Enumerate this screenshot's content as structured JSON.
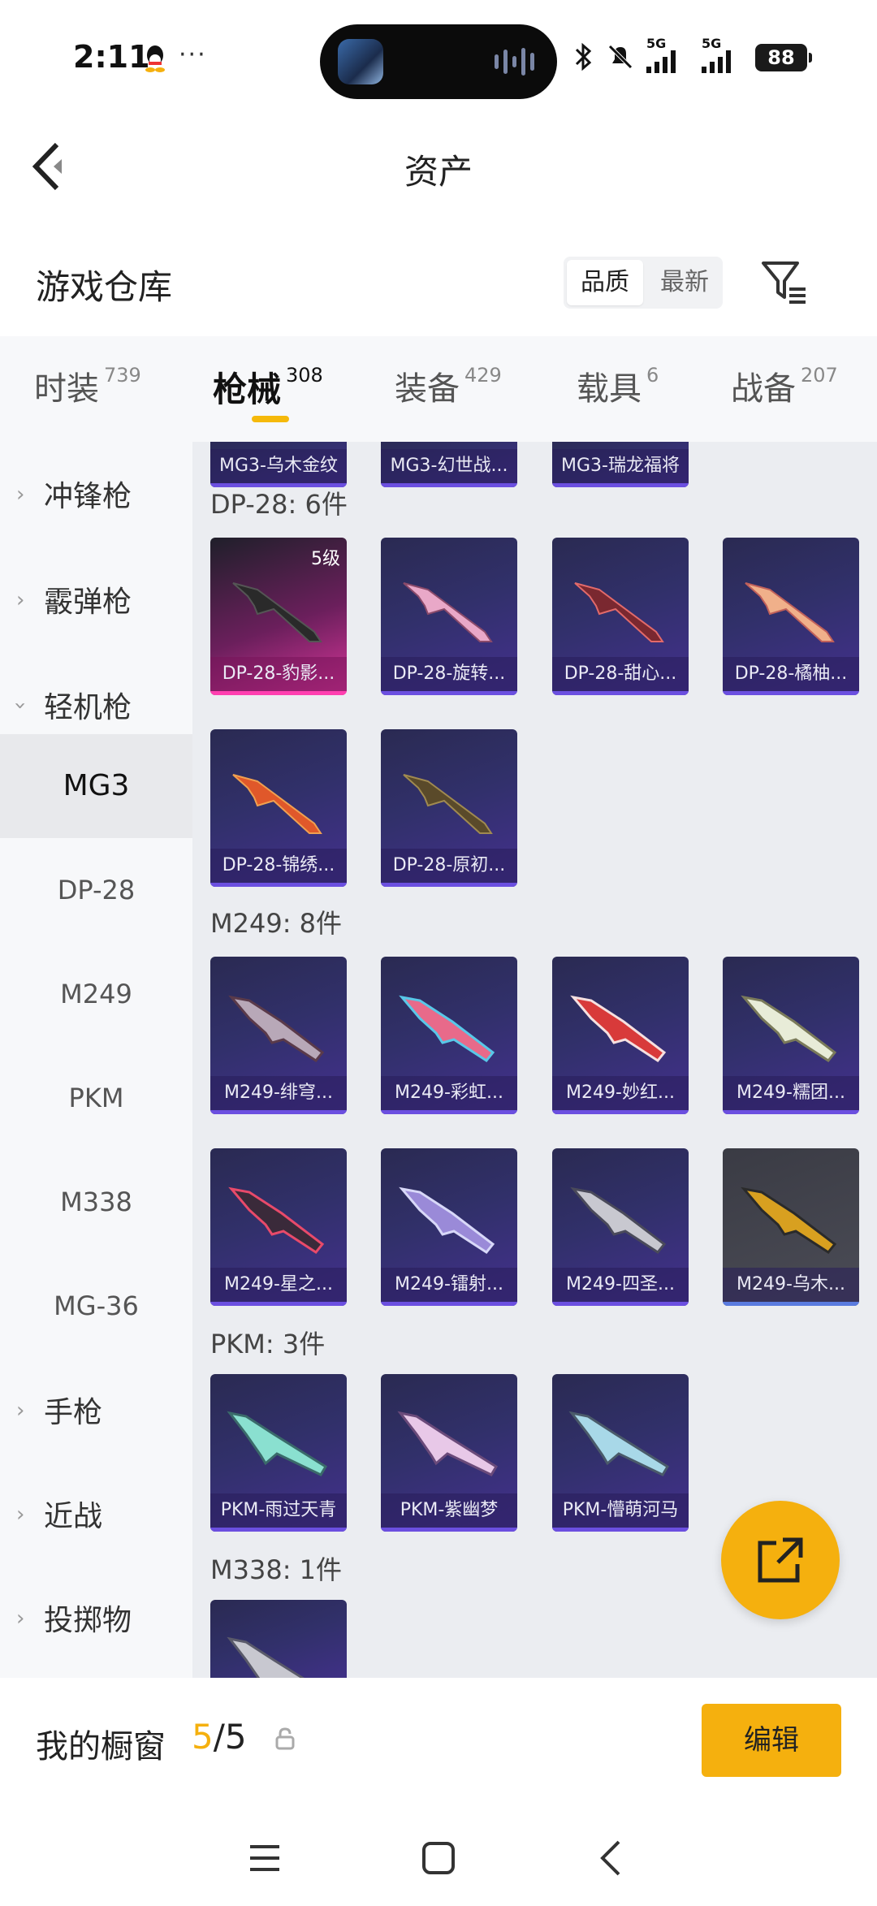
{
  "status_bar": {
    "time": "2:11",
    "dots": "···",
    "signal1": "5G",
    "signal2": "5G",
    "battery": "88"
  },
  "header": {
    "title": "资产"
  },
  "warehouse": {
    "title": "游戏仓库",
    "sort_options": [
      "品质",
      "最新"
    ]
  },
  "tabs": [
    {
      "label": "时装",
      "count": "739"
    },
    {
      "label": "枪械",
      "count": "308"
    },
    {
      "label": "装备",
      "count": "429"
    },
    {
      "label": "载具",
      "count": "6"
    },
    {
      "label": "战备",
      "count": "207"
    }
  ],
  "sidebar": {
    "groups": [
      {
        "label": "冲锋枪"
      },
      {
        "label": "霰弹枪"
      },
      {
        "label": "轻机枪"
      },
      {
        "label": "手枪"
      },
      {
        "label": "近战"
      },
      {
        "label": "投掷物"
      }
    ],
    "sub_items": [
      "MG3",
      "DP-28",
      "M249",
      "PKM",
      "M338",
      "MG-36"
    ]
  },
  "sections": {
    "top_partial": [
      "MG3-乌木金纹",
      "MG3-幻世战...",
      "MG3-瑞龙福将"
    ],
    "dp28": {
      "title": "DP-28: 6件",
      "items": [
        "DP-28-豹影...",
        "DP-28-旋转...",
        "DP-28-甜心...",
        "DP-28-橘柚...",
        "DP-28-锦绣...",
        "DP-28-原初..."
      ],
      "level_badge": "5级"
    },
    "m249": {
      "title": "M249: 8件",
      "items": [
        "M249-绯穹...",
        "M249-彩虹...",
        "M249-妙红...",
        "M249-糯团...",
        "M249-星之...",
        "M249-镭射...",
        "M249-四圣...",
        "M249-乌木..."
      ]
    },
    "pkm": {
      "title": "PKM: 3件",
      "items": [
        "PKM-雨过天青",
        "PKM-紫幽梦",
        "PKM-懵萌河马"
      ]
    },
    "m338": {
      "title": "M338: 1件"
    }
  },
  "showcase": {
    "label": "我的橱窗",
    "current": "5",
    "total": "/5",
    "edit_label": "编辑"
  },
  "colors": {
    "accent": "#f5b00e",
    "card_purple": "#31306a",
    "card_legend": "#d8369a"
  }
}
